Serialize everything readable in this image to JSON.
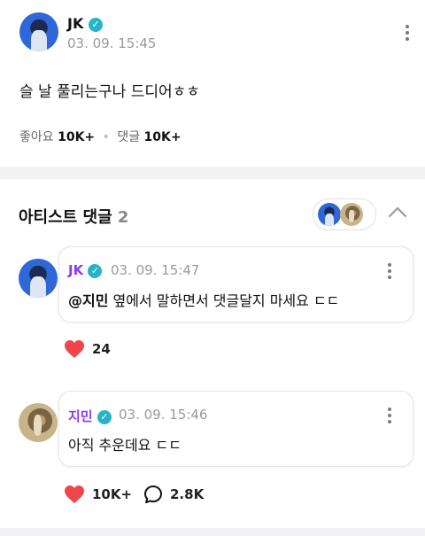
{
  "post": {
    "author": "JK",
    "timestamp": "03. 09. 15:45",
    "text": "슬 날 풀리는구나 드디어ㅎㅎ",
    "likes_label": "좋아요",
    "likes_count": "10K+",
    "separator": "•",
    "comments_label": "댓글",
    "comments_count": "10K+"
  },
  "artist_comments": {
    "title": "아티스트 댓글",
    "count": "2"
  },
  "comments": [
    {
      "author": "JK",
      "timestamp": "03. 09. 15:47",
      "mention": "@지민",
      "text": " 옆에서 말하면서 댓글달지 마세요 ㄷㄷ",
      "likes": "24"
    },
    {
      "author": "지민",
      "timestamp": "03. 09. 15:46",
      "text": "아직 추운데요 ㄷㄷ",
      "likes": "10K+",
      "replies": "2.8K"
    }
  ],
  "colors": {
    "verified": "#28b4c8",
    "artist_name": "#8a3cf0",
    "heart": "#f0464b"
  },
  "icons": {
    "verified": "check-circle",
    "more": "vertical-dots",
    "collapse": "chevron-up",
    "like": "heart",
    "reply": "speech-bubble"
  }
}
